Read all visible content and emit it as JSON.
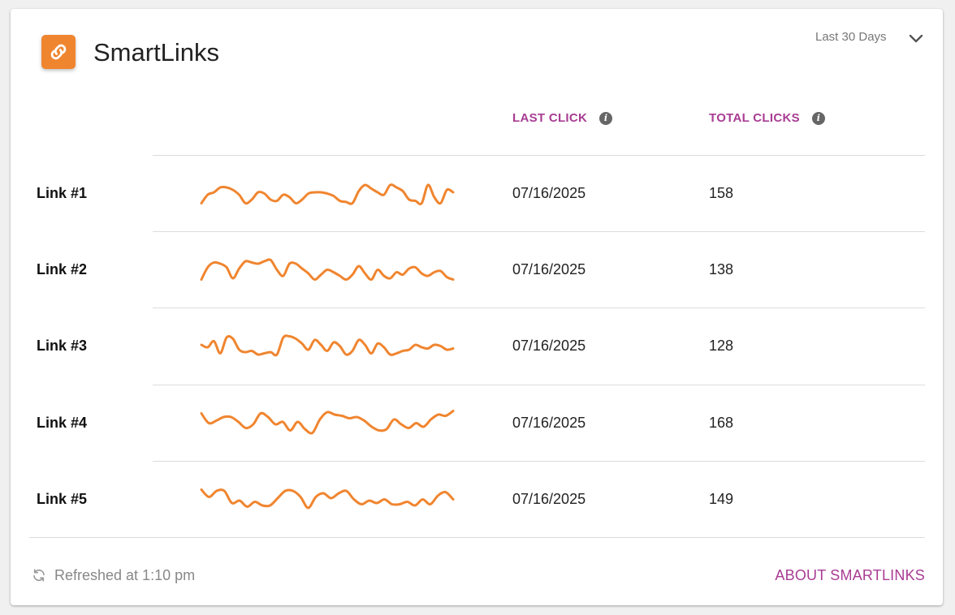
{
  "widget": {
    "title": "SmartLinks",
    "range_label": "Last 30 Days",
    "icons": {
      "app": "link-icon",
      "range": "chevron-down-icon",
      "info": "info-icon",
      "refresh": "refresh-icon"
    },
    "accent_color": "#f0852f",
    "header_color": "#a83c93"
  },
  "table": {
    "columns": {
      "last_click": "LAST CLICK",
      "total_clicks": "TOTAL CLICKS"
    },
    "rows": [
      {
        "name": "Link #1",
        "last_click": "07/16/2025",
        "total_clicks": "158",
        "trend": [
          0.95,
          0.6,
          0.5,
          0.3,
          0.3,
          0.4,
          0.6,
          0.95,
          0.8,
          0.5,
          0.55,
          0.8,
          0.85,
          0.6,
          0.7,
          0.95,
          0.8,
          0.55,
          0.5,
          0.5,
          0.55,
          0.65,
          0.85,
          0.9,
          0.95,
          0.45,
          0.2,
          0.35,
          0.5,
          0.6,
          0.2,
          0.3,
          0.45,
          0.8,
          0.85,
          0.95,
          0.2,
          0.7,
          0.95,
          0.4,
          0.5
        ]
      },
      {
        "name": "Link #2",
        "last_click": "07/16/2025",
        "total_clicks": "138",
        "trend": [
          0.95,
          0.45,
          0.25,
          0.3,
          0.45,
          0.9,
          0.5,
          0.2,
          0.25,
          0.3,
          0.2,
          0.15,
          0.55,
          0.8,
          0.3,
          0.3,
          0.5,
          0.7,
          0.95,
          0.75,
          0.55,
          0.65,
          0.8,
          0.95,
          0.75,
          0.4,
          0.7,
          0.95,
          0.55,
          0.8,
          0.9,
          0.65,
          0.75,
          0.5,
          0.45,
          0.7,
          0.8,
          0.65,
          0.6,
          0.85,
          0.95
        ]
      },
      {
        "name": "Link #3",
        "last_click": "07/16/2025",
        "total_clicks": "128",
        "trend": [
          0.5,
          0.6,
          0.35,
          0.85,
          0.2,
          0.25,
          0.7,
          0.8,
          0.75,
          0.9,
          0.85,
          0.8,
          0.9,
          0.2,
          0.15,
          0.25,
          0.45,
          0.7,
          0.3,
          0.5,
          0.75,
          0.4,
          0.55,
          0.9,
          0.75,
          0.3,
          0.5,
          0.85,
          0.45,
          0.6,
          0.9,
          0.85,
          0.75,
          0.7,
          0.5,
          0.6,
          0.65,
          0.5,
          0.55,
          0.7,
          0.65
        ]
      },
      {
        "name": "Link #4",
        "last_click": "07/16/2025",
        "total_clicks": "168",
        "trend": [
          0.15,
          0.55,
          0.45,
          0.3,
          0.3,
          0.5,
          0.75,
          0.6,
          0.15,
          0.3,
          0.6,
          0.5,
          0.85,
          0.5,
          0.8,
          0.95,
          0.4,
          0.1,
          0.2,
          0.25,
          0.35,
          0.3,
          0.45,
          0.7,
          0.85,
          0.8,
          0.4,
          0.6,
          0.75,
          0.55,
          0.7,
          0.4,
          0.2,
          0.25,
          0.05
        ]
      },
      {
        "name": "Link #5",
        "last_click": "07/16/2025",
        "total_clicks": "149",
        "trend": [
          0.15,
          0.45,
          0.2,
          0.2,
          0.7,
          0.6,
          0.85,
          0.65,
          0.8,
          0.8,
          0.5,
          0.2,
          0.2,
          0.45,
          0.9,
          0.45,
          0.3,
          0.5,
          0.3,
          0.2,
          0.55,
          0.75,
          0.6,
          0.7,
          0.55,
          0.75,
          0.75,
          0.65,
          0.8,
          0.55,
          0.75,
          0.4,
          0.25,
          0.55
        ]
      }
    ]
  },
  "footer": {
    "refreshed": "Refreshed at 1:10 pm",
    "about": "ABOUT SMARTLINKS"
  }
}
